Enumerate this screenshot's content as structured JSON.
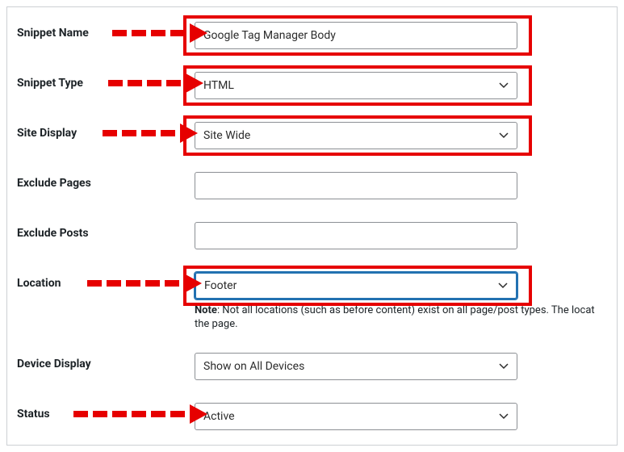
{
  "fields": {
    "snippetName": {
      "label": "Snippet Name",
      "value": "Google Tag Manager Body"
    },
    "snippetType": {
      "label": "Snippet Type",
      "value": "HTML"
    },
    "siteDisplay": {
      "label": "Site Display",
      "value": "Site Wide"
    },
    "excludePages": {
      "label": "Exclude Pages",
      "value": ""
    },
    "excludePosts": {
      "label": "Exclude Posts",
      "value": ""
    },
    "location": {
      "label": "Location",
      "value": "Footer",
      "noteBold": "Note",
      "noteText": ": Not all locations (such as before content) exist on all page/post types. The locat",
      "noteText2": "the page."
    },
    "deviceDisplay": {
      "label": "Device Display",
      "value": "Show on All Devices"
    },
    "status": {
      "label": "Status",
      "value": "Active"
    }
  }
}
